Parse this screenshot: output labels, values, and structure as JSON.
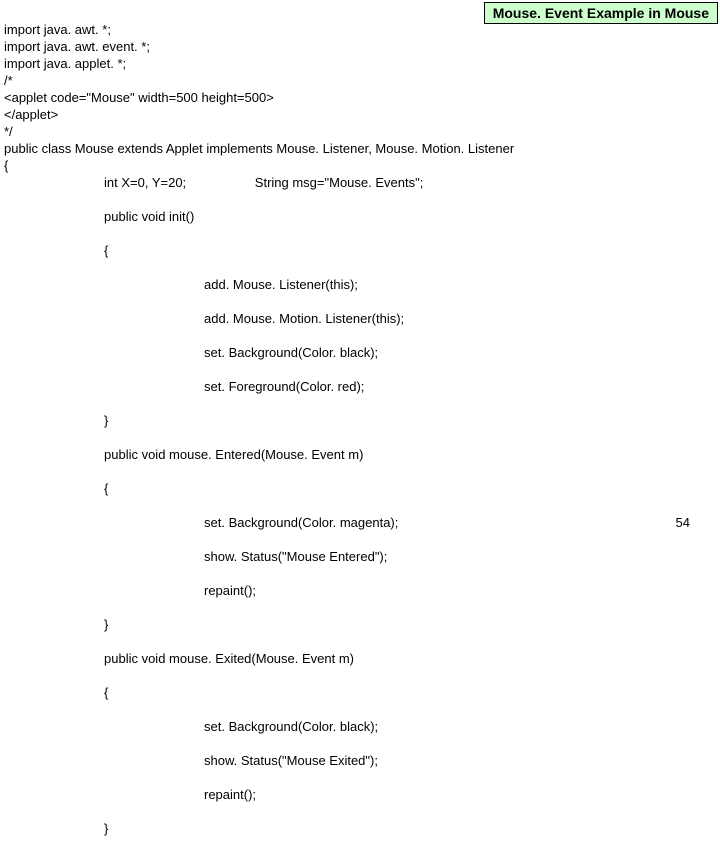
{
  "title": "Mouse. Event Example in Mouse",
  "code": {
    "l1": "import java. awt. *;",
    "l2": "import java. awt. event. *;",
    "l3": "import java. applet. *;",
    "l4": "/*",
    "l5": "<applet code=\"Mouse\" width=500 height=500>",
    "l6": "</applet>",
    "l7": "*/",
    "l8": "public class Mouse extends Applet implements Mouse. Listener, Mouse. Motion. Listener",
    "l9": "{",
    "l10": "int X=0, Y=20;                   String msg=\"Mouse. Events\";",
    "l11": "public void init()",
    "l12": "{",
    "l13": "add. Mouse. Listener(this);",
    "l14": "add. Mouse. Motion. Listener(this);",
    "l15": "set. Background(Color. black);",
    "l16": "set. Foreground(Color. red);",
    "l17": "}",
    "l18": "public void mouse. Entered(Mouse. Event m)",
    "l19": "{",
    "l20": "set. Background(Color. magenta);",
    "l21": "show. Status(\"Mouse Entered\");",
    "l22": "repaint();",
    "l23": "}",
    "l24": "public void mouse. Exited(Mouse. Event m)",
    "l25": "{",
    "l26": "set. Background(Color. black);",
    "l27": "show. Status(\"Mouse Exited\");",
    "l28": "repaint();",
    "l29": "}"
  },
  "page_number": "54"
}
